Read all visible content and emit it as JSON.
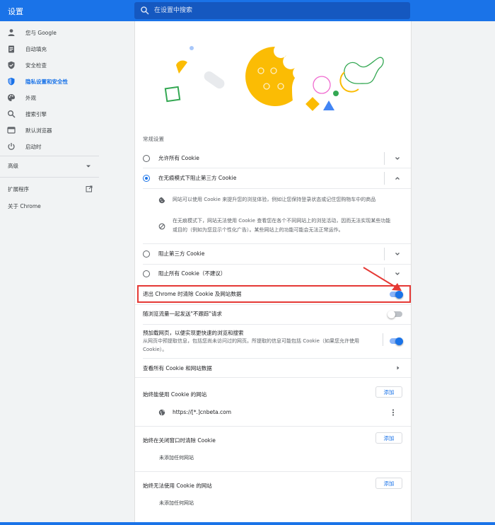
{
  "header": {
    "title": "设置",
    "search_placeholder": "在设置中搜索"
  },
  "sidebar": {
    "items": [
      {
        "label": "您与 Google",
        "icon": "person-icon"
      },
      {
        "label": "自动填充",
        "icon": "clipboard-icon"
      },
      {
        "label": "安全检查",
        "icon": "shield-check-icon"
      },
      {
        "label": "隐私设置和安全性",
        "icon": "shield-icon",
        "active": true
      },
      {
        "label": "外观",
        "icon": "palette-icon"
      },
      {
        "label": "搜索引擎",
        "icon": "search-icon"
      },
      {
        "label": "默认浏览器",
        "icon": "browser-icon"
      },
      {
        "label": "启动时",
        "icon": "power-icon"
      }
    ],
    "advanced_label": "高级",
    "extensions_label": "扩展程序",
    "about_label": "关于 Chrome"
  },
  "main": {
    "general_title": "常规设置",
    "options": [
      {
        "label": "允许所有 Cookie",
        "checked": false
      },
      {
        "label": "在无痕模式下阻止第三方 Cookie",
        "checked": true
      },
      {
        "label": "阻止第三方 Cookie",
        "checked": false
      },
      {
        "label": "阻止所有 Cookie（不建议）",
        "checked": false
      }
    ],
    "incognito_detail_1": "网站可以使用 Cookie 来提升您的浏览体验，例如让您保持登录状态或记住您购物车中的商品",
    "incognito_detail_2_line1": "在无痕模式下，网站无法使用 Cookie 查看您在各个不同网站上的浏览活动，因而无法实现某些功能",
    "incognito_detail_2_line2": "或目的（例如为您显示个性化广告）。某些网站上的功能可能会无法正常运作。",
    "clear_on_exit_label": "退出 Chrome 时清除 Cookie 及网站数据",
    "clear_on_exit_on": true,
    "do_not_track_label": "随浏览流量一起发送\"不跟踪\"请求",
    "do_not_track_on": false,
    "preload_title": "预加载网页，以便实现更快速的浏览和搜索",
    "preload_desc_line1": "从网页中预提取信息，包括您尚未访问过的网页。所提取的信息可能包括 Cookie（如果您允许使用",
    "preload_desc_line2": "Cookie）。",
    "preload_on": true,
    "see_all_label": "查看所有 Cookie 和网站数据",
    "always_allow_label": "始终能使用 Cookie 的网站",
    "allow_site": "https://[*.]cnbeta.com",
    "clear_on_close_label": "始终在关闭窗口时清除 Cookie",
    "no_sites_1": "未添加任何网站",
    "never_allow_label": "始终无法使用 Cookie 的网站",
    "no_sites_2": "未添加任何网站",
    "add_label": "添加"
  },
  "colors": {
    "accent": "#1a73e8",
    "highlight": "#e53935"
  }
}
